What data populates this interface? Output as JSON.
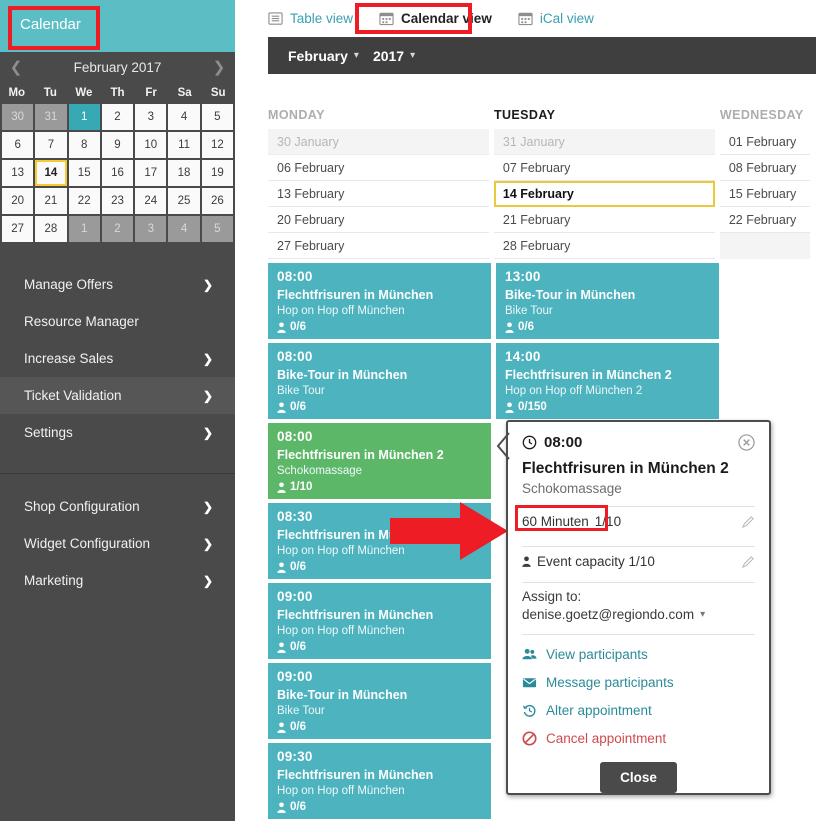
{
  "sidebar": {
    "header_label": "Calendar",
    "mini_calendar": {
      "month_label": "February 2017",
      "prev_icon": "chevron-left-icon",
      "next_icon": "chevron-right-icon",
      "dow": [
        "Mo",
        "Tu",
        "We",
        "Th",
        "Fr",
        "Sa",
        "Su"
      ],
      "weeks": [
        [
          {
            "d": "30",
            "st": "muted"
          },
          {
            "d": "31",
            "st": "muted"
          },
          {
            "d": "1",
            "st": "sel"
          },
          {
            "d": "2",
            "st": ""
          },
          {
            "d": "3",
            "st": ""
          },
          {
            "d": "4",
            "st": ""
          },
          {
            "d": "5",
            "st": ""
          }
        ],
        [
          {
            "d": "6",
            "st": ""
          },
          {
            "d": "7",
            "st": ""
          },
          {
            "d": "8",
            "st": ""
          },
          {
            "d": "9",
            "st": ""
          },
          {
            "d": "10",
            "st": ""
          },
          {
            "d": "11",
            "st": ""
          },
          {
            "d": "12",
            "st": ""
          }
        ],
        [
          {
            "d": "13",
            "st": ""
          },
          {
            "d": "14",
            "st": "today"
          },
          {
            "d": "15",
            "st": ""
          },
          {
            "d": "16",
            "st": ""
          },
          {
            "d": "17",
            "st": ""
          },
          {
            "d": "18",
            "st": ""
          },
          {
            "d": "19",
            "st": ""
          }
        ],
        [
          {
            "d": "20",
            "st": ""
          },
          {
            "d": "21",
            "st": ""
          },
          {
            "d": "22",
            "st": ""
          },
          {
            "d": "23",
            "st": ""
          },
          {
            "d": "24",
            "st": ""
          },
          {
            "d": "25",
            "st": ""
          },
          {
            "d": "26",
            "st": ""
          }
        ],
        [
          {
            "d": "27",
            "st": ""
          },
          {
            "d": "28",
            "st": ""
          },
          {
            "d": "1",
            "st": "muted"
          },
          {
            "d": "2",
            "st": "muted"
          },
          {
            "d": "3",
            "st": "muted"
          },
          {
            "d": "4",
            "st": "muted"
          },
          {
            "d": "5",
            "st": "muted"
          }
        ]
      ]
    },
    "nav_group_1": [
      {
        "label": "Manage Offers",
        "chevron": true,
        "active": false
      },
      {
        "label": "Resource Manager",
        "chevron": false,
        "active": false
      },
      {
        "label": "Increase Sales",
        "chevron": true,
        "active": false
      },
      {
        "label": "Ticket Validation",
        "chevron": true,
        "active": true
      },
      {
        "label": "Settings",
        "chevron": true,
        "active": false
      }
    ],
    "nav_group_2": [
      {
        "label": "Shop Configuration",
        "chevron": true,
        "active": false
      },
      {
        "label": "Widget Configuration",
        "chevron": true,
        "active": false
      },
      {
        "label": "Marketing",
        "chevron": true,
        "active": false
      }
    ]
  },
  "main": {
    "view_tabs": [
      {
        "label": "Table view",
        "icon": "list-icon",
        "current": false
      },
      {
        "label": "Calendar view",
        "icon": "calendar-icon",
        "current": true
      },
      {
        "label": "iCal view",
        "icon": "calendar-icon",
        "current": false
      }
    ],
    "month_bar": {
      "month": "February",
      "year": "2017",
      "caret": "▾"
    },
    "columns": [
      {
        "day": "MONDAY",
        "current": false
      },
      {
        "day": "TUESDAY",
        "current": true
      },
      {
        "day": "WEDNESDAY",
        "current": false
      }
    ],
    "date_rows": [
      [
        {
          "t": "30 January",
          "s": "out"
        },
        {
          "t": "31 January",
          "s": "out"
        },
        {
          "t": "01 February",
          "s": ""
        }
      ],
      [
        {
          "t": "06 February",
          "s": ""
        },
        {
          "t": "07 February",
          "s": ""
        },
        {
          "t": "08 February",
          "s": ""
        }
      ],
      [
        {
          "t": "13 February",
          "s": ""
        },
        {
          "t": "14 February",
          "s": "sel"
        },
        {
          "t": "15 February",
          "s": ""
        }
      ],
      [
        {
          "t": "20 February",
          "s": ""
        },
        {
          "t": "21 February",
          "s": ""
        },
        {
          "t": "22 February",
          "s": ""
        }
      ],
      [
        {
          "t": "27 February",
          "s": ""
        },
        {
          "t": "28 February",
          "s": ""
        },
        {
          "t": "",
          "s": "empty"
        }
      ]
    ],
    "monday_events": [
      {
        "time": "08:00",
        "name": "Flechtfrisuren in München",
        "sub": "Hop on Hop off München",
        "cap": "0/6",
        "color": "teal"
      },
      {
        "time": "08:00",
        "name": "Bike-Tour in München",
        "sub": "Bike Tour",
        "cap": "0/6",
        "color": "teal"
      },
      {
        "time": "08:00",
        "name": "Flechtfrisuren in München 2",
        "sub": "Schokomassage",
        "cap": "1/10",
        "color": "green"
      },
      {
        "time": "08:30",
        "name": "Flechtfrisuren in München",
        "sub": "Hop on Hop off München",
        "cap": "0/6",
        "color": "teal"
      },
      {
        "time": "09:00",
        "name": "Flechtfrisuren in München",
        "sub": "Hop on Hop off München",
        "cap": "0/6",
        "color": "teal"
      },
      {
        "time": "09:00",
        "name": "Bike-Tour in München",
        "sub": "Bike Tour",
        "cap": "0/6",
        "color": "teal"
      },
      {
        "time": "09:30",
        "name": "Flechtfrisuren in München",
        "sub": "Hop on Hop off München",
        "cap": "0/6",
        "color": "teal"
      }
    ],
    "tuesday_events": [
      {
        "time": "13:00",
        "name": "Bike-Tour in München",
        "sub": "Bike Tour",
        "cap": "0/6",
        "color": "teal"
      },
      {
        "time": "14:00",
        "name": "Flechtfrisuren in München 2",
        "sub": "Hop on Hop off München 2",
        "cap": "0/150",
        "color": "teal"
      }
    ]
  },
  "popup": {
    "time": "08:00",
    "clock_icon": "clock-icon",
    "close_x_icon": "close-circle-icon",
    "title": "Flechtfrisuren in München 2",
    "subtitle": "Schokomassage",
    "duration_label": "60 Minuten",
    "duration_value": "1/10",
    "capacity_label": "Event capacity 1/10",
    "edit_icon": "pencil-icon",
    "assign_label": "Assign to:",
    "assign_value": "denise.goetz@regiondo.com",
    "assign_caret": "▾",
    "actions": [
      {
        "label": "View participants",
        "icon": "users-icon",
        "danger": false
      },
      {
        "label": "Message participants",
        "icon": "envelope-icon",
        "danger": false
      },
      {
        "label": "Alter appointment",
        "icon": "history-icon",
        "danger": false
      },
      {
        "label": "Cancel appointment",
        "icon": "ban-icon",
        "danger": true
      }
    ],
    "close_label": "Close"
  },
  "annotations": {
    "red_arrow": "red-right-arrow",
    "highlight_color": "#ee1c25",
    "accent_teal": "#4cb3bf",
    "accent_green": "#5cb868",
    "today_outline": "#eec83c"
  }
}
